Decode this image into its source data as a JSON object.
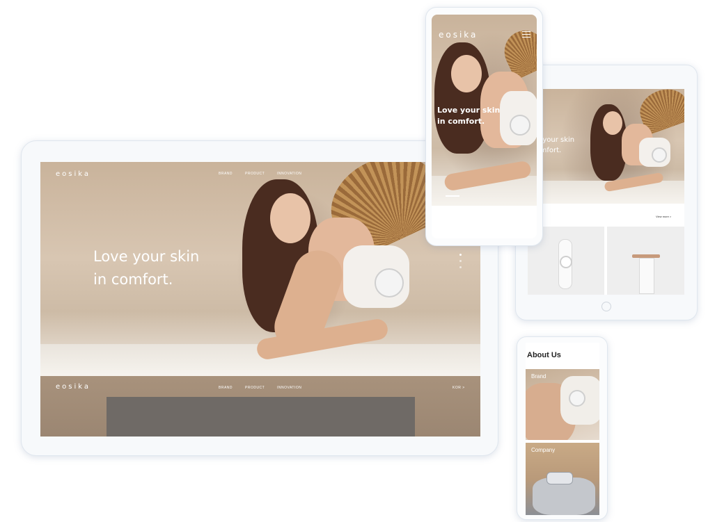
{
  "desktop": {
    "brand": "eosika",
    "nav": [
      "BRAND",
      "PRODUCT",
      "INNOVATION"
    ],
    "headline": [
      "Love your skin",
      "in comfort."
    ],
    "footer_brand": "eosika",
    "footer_nav": [
      "BRAND",
      "PRODUCT",
      "INNOVATION"
    ],
    "footer_link": "KOR >"
  },
  "phone_top": {
    "brand": "eosika",
    "headline": [
      "Love your skin",
      "in comfort."
    ]
  },
  "tablet": {
    "brand_fragment": "ka",
    "headline": [
      "ove your skin",
      "comfort."
    ],
    "section_title": "duct",
    "more_link": "View more >"
  },
  "phone_bottom": {
    "title": "About Us",
    "cards": [
      "Brand",
      "Company"
    ]
  },
  "icons": [
    "hamburger-icon",
    "home-button-icon"
  ]
}
